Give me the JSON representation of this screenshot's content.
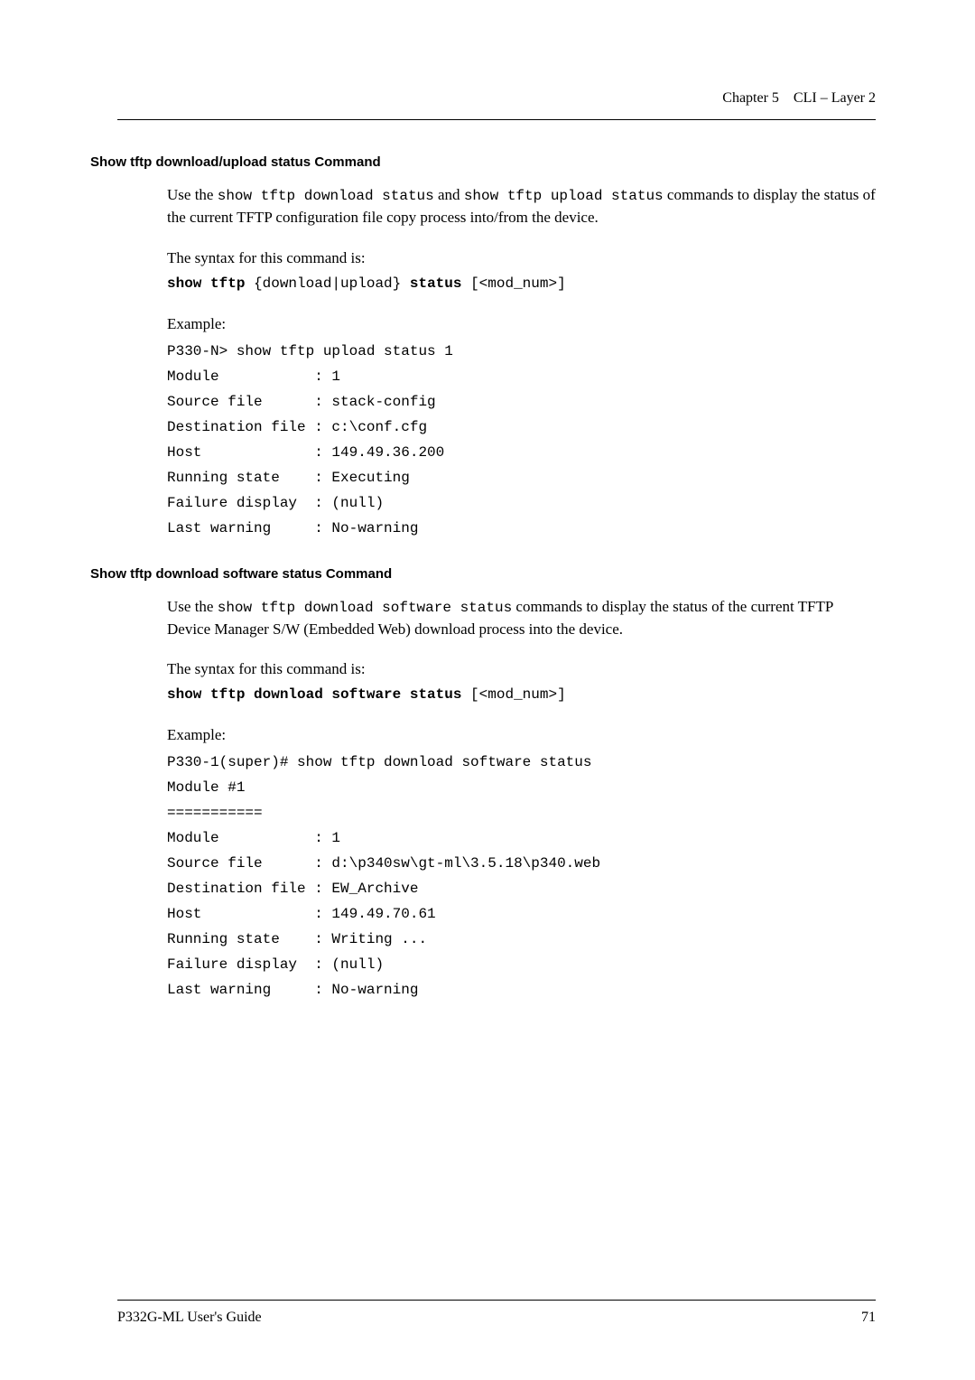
{
  "header": {
    "chapter": "Chapter 5",
    "subtitle": "CLI – Layer 2"
  },
  "section1": {
    "title": "Show tftp download/upload status Command",
    "intro_pre": "Use the ",
    "intro_code1": "show tftp download status",
    "intro_mid": " and ",
    "intro_code2": "show tftp upload status",
    "intro_post": " commands to display the status of the current TFTP configuration file copy process into/from the device.",
    "syntax_label": "The syntax for this command is:",
    "syntax_b1": "show tftp",
    "syntax_p1": " {download|upload} ",
    "syntax_b2": "status",
    "syntax_p2": " [<mod_num>]",
    "example_label": "Example:",
    "example_code": "P330-N> show tftp upload status 1\nModule           : 1\nSource file      : stack-config\nDestination file : c:\\conf.cfg\nHost             : 149.49.36.200\nRunning state    : Executing\nFailure display  : (null)\nLast warning     : No-warning"
  },
  "section2": {
    "title": "Show tftp download software status Command",
    "intro_pre": "Use the ",
    "intro_code": "show tftp download software status",
    "intro_post": " commands to display the status of the current TFTP Device Manager S/W (Embedded Web) download process into the device.",
    "syntax_label": "The syntax for this command is:",
    "syntax_b1": "show tftp download software status",
    "syntax_p1": " [<mod_num>]",
    "example_label": "Example:",
    "example_code": "P330-1(super)# show tftp download software status\nModule #1\n===========\nModule           : 1\nSource file      : d:\\p340sw\\gt-ml\\3.5.18\\p340.web\nDestination file : EW_Archive\nHost             : 149.49.70.61\nRunning state    : Writing ...\nFailure display  : (null)\nLast warning     : No-warning"
  },
  "footer": {
    "left": "P332G-ML User's Guide",
    "right": "71"
  }
}
